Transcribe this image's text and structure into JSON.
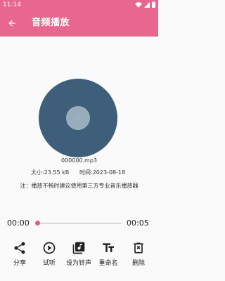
{
  "status_bar": {
    "time": "11:14"
  },
  "app_bar": {
    "title": "音频播放"
  },
  "file": {
    "name": "000000.mp3"
  },
  "meta": {
    "size": "大小:23.55 kB",
    "time": "时间:2023-08-18"
  },
  "notice": "注：播放不畅时建议使用第三方专业音乐播放器",
  "player": {
    "current_time": "00:00",
    "total_time": "00:05",
    "progress": 0
  },
  "actions": [
    {
      "label": "分享",
      "icon": "share-icon"
    },
    {
      "label": "试听",
      "icon": "play-circle-icon"
    },
    {
      "label": "设为铃声",
      "icon": "library-music-icon"
    },
    {
      "label": "重命名",
      "icon": "text-fields-icon"
    },
    {
      "label": "删除",
      "icon": "delete-icon"
    }
  ],
  "colors": {
    "primary": "#e8678f",
    "disc": "#3f5e79",
    "disc_center": "#9bb0be",
    "icon": "#222222"
  }
}
